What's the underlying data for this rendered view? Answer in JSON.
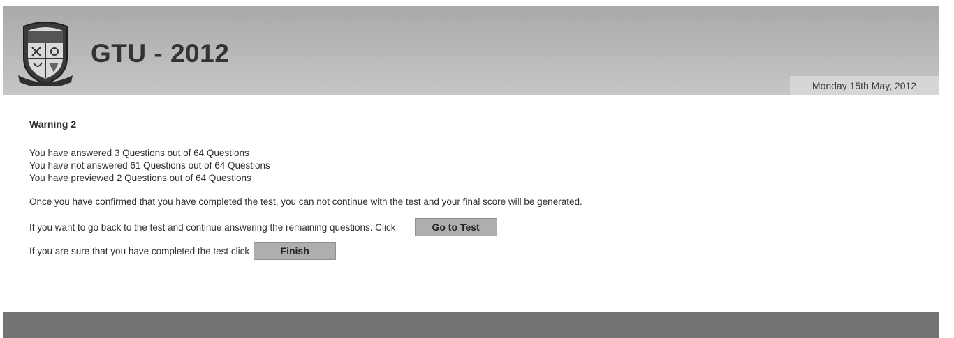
{
  "header": {
    "title": "GTU - 2012",
    "date": "Monday 15th May, 2012",
    "logo_icon": "university-crest-icon"
  },
  "warning": {
    "title": "Warning 2",
    "answered": "You have answered 3 Questions out of 64 Questions",
    "not_answered": "You have not answered 61 Questions out of 64 Questions",
    "previewed": "You have previewed 2 Questions out of 64 Questions",
    "confirm_text": "Once you have confirmed that you have completed the test, you can not continue with the test and your final score will be generated.",
    "goto_prompt": "If you want to go back to the test and continue answering the remaining questions.  Click",
    "goto_label": "Go to Test",
    "finish_prompt": "If you are sure that you have completed the test click",
    "finish_label": "Finish"
  },
  "colors": {
    "header_bg": "#b8b8ba",
    "date_bg": "#d6d6d8",
    "button_bg": "#aeaeb0",
    "footer_bg": "#737375"
  }
}
